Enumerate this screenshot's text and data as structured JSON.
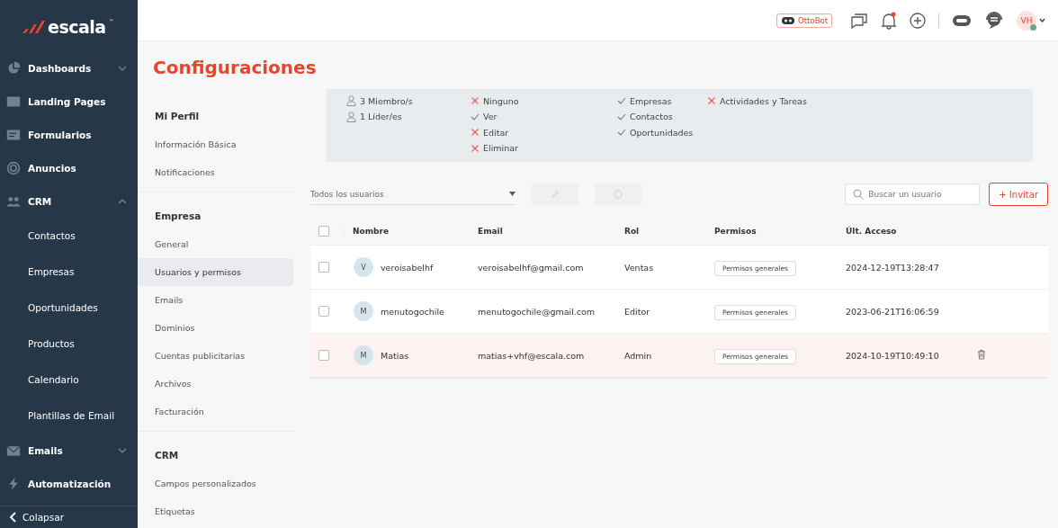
{
  "sidebar": {
    "logo": "escala",
    "logo_mark": "™",
    "items": [
      {
        "kind": "pie",
        "label": "Dashboards",
        "expanded": false
      },
      {
        "kind": "page",
        "label": "Landing Pages"
      },
      {
        "kind": "form",
        "label": "Formularios"
      },
      {
        "kind": "target",
        "label": "Anuncios"
      },
      {
        "kind": "people",
        "label": "CRM",
        "expanded": true,
        "children": [
          {
            "label": "Contactos"
          },
          {
            "label": "Empresas"
          },
          {
            "label": "Oportunidades"
          },
          {
            "label": "Productos"
          },
          {
            "label": "Calendario"
          },
          {
            "label": "Plantillas de Email"
          }
        ]
      },
      {
        "kind": "mail",
        "label": "Emails",
        "expanded": false
      },
      {
        "kind": "bolt",
        "label": "Automatización"
      }
    ],
    "collapse": "Colapsar"
  },
  "header": {
    "ottobot": "OttoBot",
    "avatar": "VH",
    "notification": true
  },
  "title": "Configuraciones",
  "settings_menu": [
    {
      "heading": "Mi Perfil",
      "items": [
        {
          "label": "Información Básica",
          "selected": false
        },
        {
          "label": "Notificaciones",
          "selected": false
        }
      ]
    },
    {
      "heading": "Empresa",
      "items": [
        {
          "label": "General",
          "selected": false
        },
        {
          "label": "Usuarios y permisos",
          "selected": true
        },
        {
          "label": "Emails",
          "selected": false
        },
        {
          "label": "Dominios",
          "selected": false
        },
        {
          "label": "Cuentas publicitarias",
          "selected": false
        },
        {
          "label": "Archivos",
          "selected": false
        },
        {
          "label": "Facturación",
          "selected": false
        }
      ]
    },
    {
      "heading": "CRM",
      "items": [
        {
          "label": "Campos personalizados",
          "selected": false
        },
        {
          "label": "Etiquetas",
          "selected": false
        }
      ]
    }
  ],
  "summary": {
    "counts": [
      "3 Miembro/s",
      "1 Líder/es"
    ],
    "columns": [
      [
        {
          "label": "Ninguno",
          "allowed": false
        },
        {
          "label": "Ver",
          "allowed": true
        },
        {
          "label": "Editar",
          "allowed": false
        },
        {
          "label": "Eliminar",
          "allowed": false
        }
      ],
      [
        {
          "label": "Empresas",
          "allowed": true
        },
        {
          "label": "Contactos",
          "allowed": true
        },
        {
          "label": "Oportunidades",
          "allowed": true
        }
      ],
      [
        {
          "label": "Actividades y Tareas",
          "allowed": false
        }
      ]
    ]
  },
  "toolbar": {
    "filter": "Todos los usuarios",
    "search_placeholder": "Buscar un usuario",
    "invite": "+ Invitar"
  },
  "table": {
    "select_all_checked": false,
    "columns": [
      "Nombre",
      "Email",
      "Rol",
      "Permisos",
      "Últ. Acceso"
    ],
    "rows": [
      {
        "initial": "V",
        "name": "veroisabelhf",
        "email": "veroisabelhf@gmail.com",
        "role": "Ventas",
        "permissions": "Permisos generales",
        "last_access": "2024-12-19T13:28:47",
        "checked": false,
        "hovered": false
      },
      {
        "initial": "M",
        "name": "menutogochile",
        "email": "menutogochile@gmail.com",
        "role": "Editor",
        "permissions": "Permisos generales",
        "last_access": "2023-06-21T16:06:59",
        "checked": false,
        "hovered": false
      },
      {
        "initial": "M",
        "name": "Matias",
        "email": "matias+vhf@escala.com",
        "role": "Admin",
        "permissions": "Permisos generales",
        "last_access": "2024-10-19T10:49:10",
        "checked": false,
        "hovered": true
      }
    ]
  }
}
